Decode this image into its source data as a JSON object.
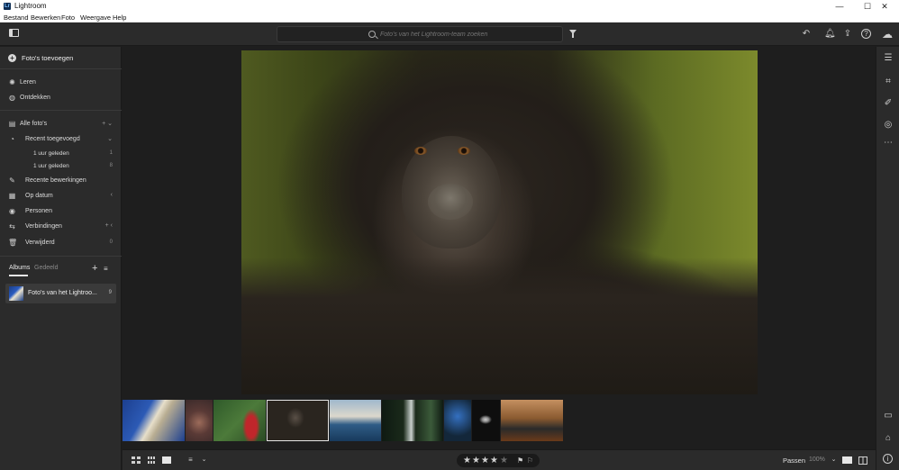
{
  "window": {
    "title": "Lightroom",
    "minimize": "—",
    "maximize": "☐",
    "close": "✕"
  },
  "menu": [
    "Bestand",
    "Bewerken",
    "Foto",
    "Weergave",
    "Help"
  ],
  "search": {
    "placeholder": "Foto's van het Lightroom-team zoeken"
  },
  "sidebar": {
    "add_photos": "Foto's toevoegen",
    "learn": "Leren",
    "discover": "Ontdekken",
    "all_photos": "Alle foto's",
    "recently_added": "Recent toegevoegd",
    "recent_sub": [
      {
        "label": "1 uur geleden",
        "count": "1"
      },
      {
        "label": "1 uur geleden",
        "count": "8"
      }
    ],
    "recent_edits": "Recente bewerkingen",
    "by_date": "Op datum",
    "people": "Personen",
    "connections": "Verbindingen",
    "deleted": "Verwijderd",
    "deleted_count": "0"
  },
  "albums": {
    "tab_albums": "Albums",
    "tab_shared": "Gedeeld",
    "items": [
      {
        "name": "Foto's van het Lightroo...",
        "count": "9"
      }
    ]
  },
  "filmstrip": {
    "selected_index": 3,
    "thumbs": [
      {
        "subject": "greek columns",
        "colors": [
          "#1c3f8f",
          "#e7dfca"
        ]
      },
      {
        "subject": "cake",
        "colors": [
          "#3b2a2a",
          "#9c6b5a"
        ]
      },
      {
        "subject": "woman in red dress",
        "colors": [
          "#2f5a2a",
          "#c0262b"
        ]
      },
      {
        "subject": "gorilla",
        "colors": [
          "#2a251f",
          "#5a5a2a"
        ]
      },
      {
        "subject": "whale tail",
        "colors": [
          "#2f5c86",
          "#dcd8cc"
        ]
      },
      {
        "subject": "waterfall",
        "colors": [
          "#0f1a12",
          "#3b5a3a"
        ]
      },
      {
        "subject": "hand with blue object",
        "colors": [
          "#13273a",
          "#3470c0"
        ]
      },
      {
        "subject": "bird",
        "colors": [
          "#0e0e0e",
          "#cfcfcf"
        ]
      },
      {
        "subject": "group photo",
        "colors": [
          "#6a3a1a",
          "#c49060"
        ]
      }
    ]
  },
  "bottombar": {
    "rating": 4,
    "rating_max": 5,
    "fit": "Passen",
    "zoom": "100%"
  },
  "colors": {
    "panel": "#2b2b2b",
    "canvas": "#1e1e1e",
    "text": "#dcdcdc"
  }
}
